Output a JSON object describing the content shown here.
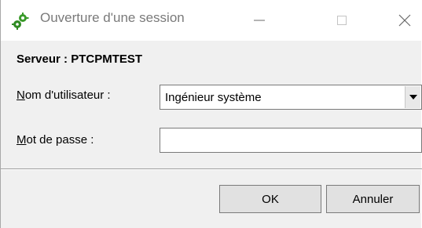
{
  "window": {
    "title": "Ouverture d'une session",
    "icon": "green-cogs-icon",
    "controls": [
      "minimize-icon",
      "maximize-icon",
      "close-icon"
    ]
  },
  "server": {
    "label": "Serveur : PTCPMTEST"
  },
  "fields": {
    "username": {
      "label_access_key": "N",
      "label_rest": "om d'utilisateur :",
      "value": "Ingénieur système"
    },
    "password": {
      "label_access_key": "M",
      "label_rest": "ot de passe :",
      "value": ""
    }
  },
  "buttons": {
    "ok_label": "OK",
    "cancel_label": "Annuler"
  },
  "colors": {
    "icon_green": "#3a9a2a",
    "title_text": "#7a7a7a",
    "dialog_bg": "#f0f0f0"
  }
}
